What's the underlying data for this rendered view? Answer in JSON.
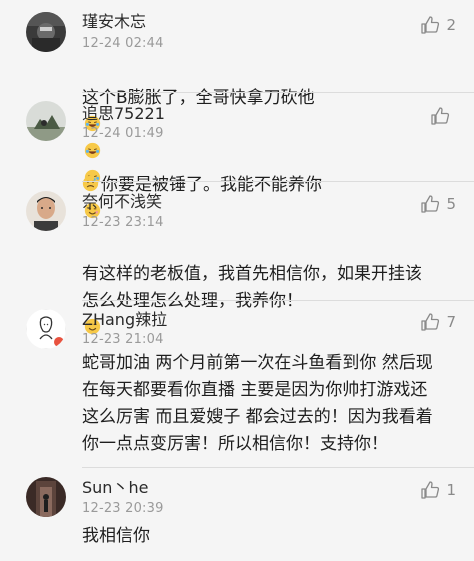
{
  "comments": [
    {
      "username": "瑾安木忘",
      "time": "12-24 02:44",
      "text": "这个B膨胀了，全哥快拿刀砍他",
      "emoji_trailing": [
        "laugh-cry-emoji",
        "laugh-cry-emoji",
        "laugh-cry-emoji"
      ],
      "likes": "2",
      "avatar": "avatar-dark-photo"
    },
    {
      "username": "追思75221",
      "time": "12-24 01:49",
      "text_before": "",
      "emoji_leading": "sweat-emoji",
      "text": "你要是被锤了。我能不能养你",
      "emoji_trailing": [
        "wink-emoji"
      ],
      "likes": "",
      "avatar": "avatar-landscape-photo"
    },
    {
      "username": "奈何不浅笑",
      "time": "12-23 23:14",
      "text": "有这样的老板值，我首先相信你，如果开挂该\n怎么处理怎么处理，我养你！",
      "emoji_trailing": [
        "smile-emoji"
      ],
      "likes": "5",
      "avatar": "avatar-face-photo"
    },
    {
      "username": "ZHang辣拉",
      "time": "12-23 21:04",
      "text": "蛇哥加油 两个月前第一次在斗鱼看到你 然后现\n在每天都要看你直播 主要是因为你帅打游戏还\n这么厉害 而且爱嫂子 都会过去的！因为我看着\n你一点点变厉害！所以相信你！支持你！",
      "emoji_trailing": [],
      "likes": "7",
      "avatar": "avatar-sketch-drawing"
    },
    {
      "username": "Sun丶he",
      "time": "12-23 20:39",
      "text": "我相信你",
      "emoji_trailing": [],
      "likes": "1",
      "avatar": "avatar-doorway-photo"
    }
  ],
  "colors": {
    "background": "#f5f5f5",
    "username": "#2a2a2a",
    "timestamp": "#9a9a9a",
    "body_text": "#1e1e1e",
    "like_icon": "#8a8a8a",
    "emoji_face": "#f7c948"
  }
}
